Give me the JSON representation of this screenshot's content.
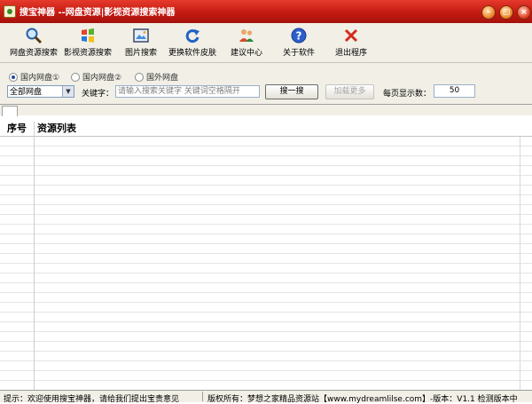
{
  "window": {
    "title": "搜宝神器 --网盘资源|影视资源搜索神器",
    "minimize_label": "–",
    "maximize_label": "□",
    "close_label": "×"
  },
  "toolbar": {
    "items": [
      {
        "label": "网盘资源搜索",
        "icon": "magnifier-icon"
      },
      {
        "label": "影视资源搜索",
        "icon": "windows-flag-icon"
      },
      {
        "label": "图片搜索",
        "icon": "picture-icon"
      },
      {
        "label": "更换软件皮肤",
        "icon": "refresh-icon"
      },
      {
        "label": "建议中心",
        "icon": "users-icon"
      },
      {
        "label": "关于软件",
        "icon": "help-icon"
      },
      {
        "label": "退出程序",
        "icon": "exit-x-icon"
      }
    ]
  },
  "search": {
    "radios": [
      {
        "label": "国内网盘①",
        "checked": true
      },
      {
        "label": "国内网盘②",
        "checked": false
      },
      {
        "label": "国外网盘",
        "checked": false
      }
    ],
    "disk_select_value": "全部网盘",
    "keyword_label": "关键字：",
    "keyword_placeholder": "请输入搜索关键字 关键词空格隔开",
    "search_button": "搜一搜",
    "load_more_button": "加载更多",
    "per_page_label": "每页显示数：",
    "per_page_value": "50"
  },
  "results": {
    "columns": [
      "序号",
      "资源列表"
    ]
  },
  "statusbar": {
    "tip": "提示：欢迎使用搜宝神器，请给我们提出宝贵意见",
    "copyright": "版权所有：梦想之家精品资源站【www.mydreamlilse.com】-版本：V1.1  检测版本中"
  },
  "colors": {
    "titlebar": "#c51a12",
    "toolbar_bg": "#f1efe6"
  }
}
